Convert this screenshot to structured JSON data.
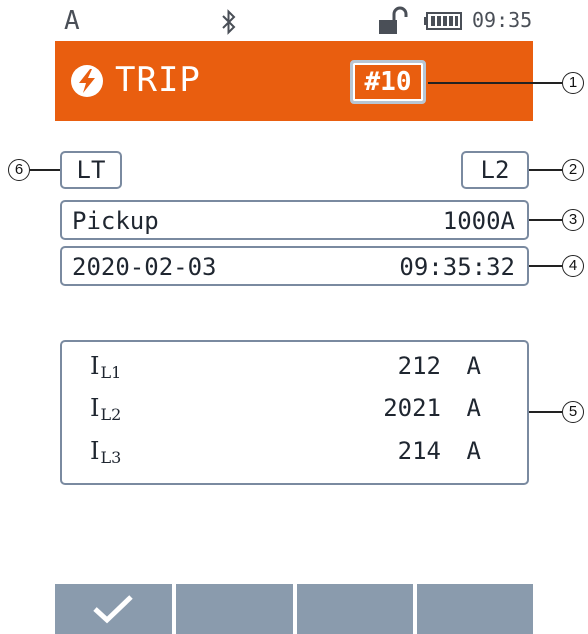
{
  "status_bar": {
    "mode_letter": "A",
    "bluetooth_icon": "bluetooth-icon",
    "lock_icon": "unlocked-padlock-icon",
    "battery_icon": "battery-icon",
    "time": "09:35"
  },
  "header": {
    "icon": "lightning-bolt-icon",
    "title": "TRIP",
    "event_number": "#10",
    "color": "#e95e0f"
  },
  "tags": {
    "left": "LT",
    "right": "L2"
  },
  "pickup": {
    "label": "Pickup",
    "value": "1000A"
  },
  "timestamp": {
    "date": "2020-02-03",
    "time": "09:35:32"
  },
  "currents": [
    {
      "symbol": "I",
      "phase": "L1",
      "value": "212",
      "unit": "A"
    },
    {
      "symbol": "I",
      "phase": "L2",
      "value": "2021",
      "unit": "A"
    },
    {
      "symbol": "I",
      "phase": "L3",
      "value": "214",
      "unit": "A"
    }
  ],
  "callouts": [
    "1",
    "2",
    "3",
    "4",
    "5",
    "6"
  ],
  "softkeys": [
    {
      "icon": "checkmark-icon"
    },
    {
      "icon": ""
    },
    {
      "icon": ""
    },
    {
      "icon": ""
    }
  ]
}
